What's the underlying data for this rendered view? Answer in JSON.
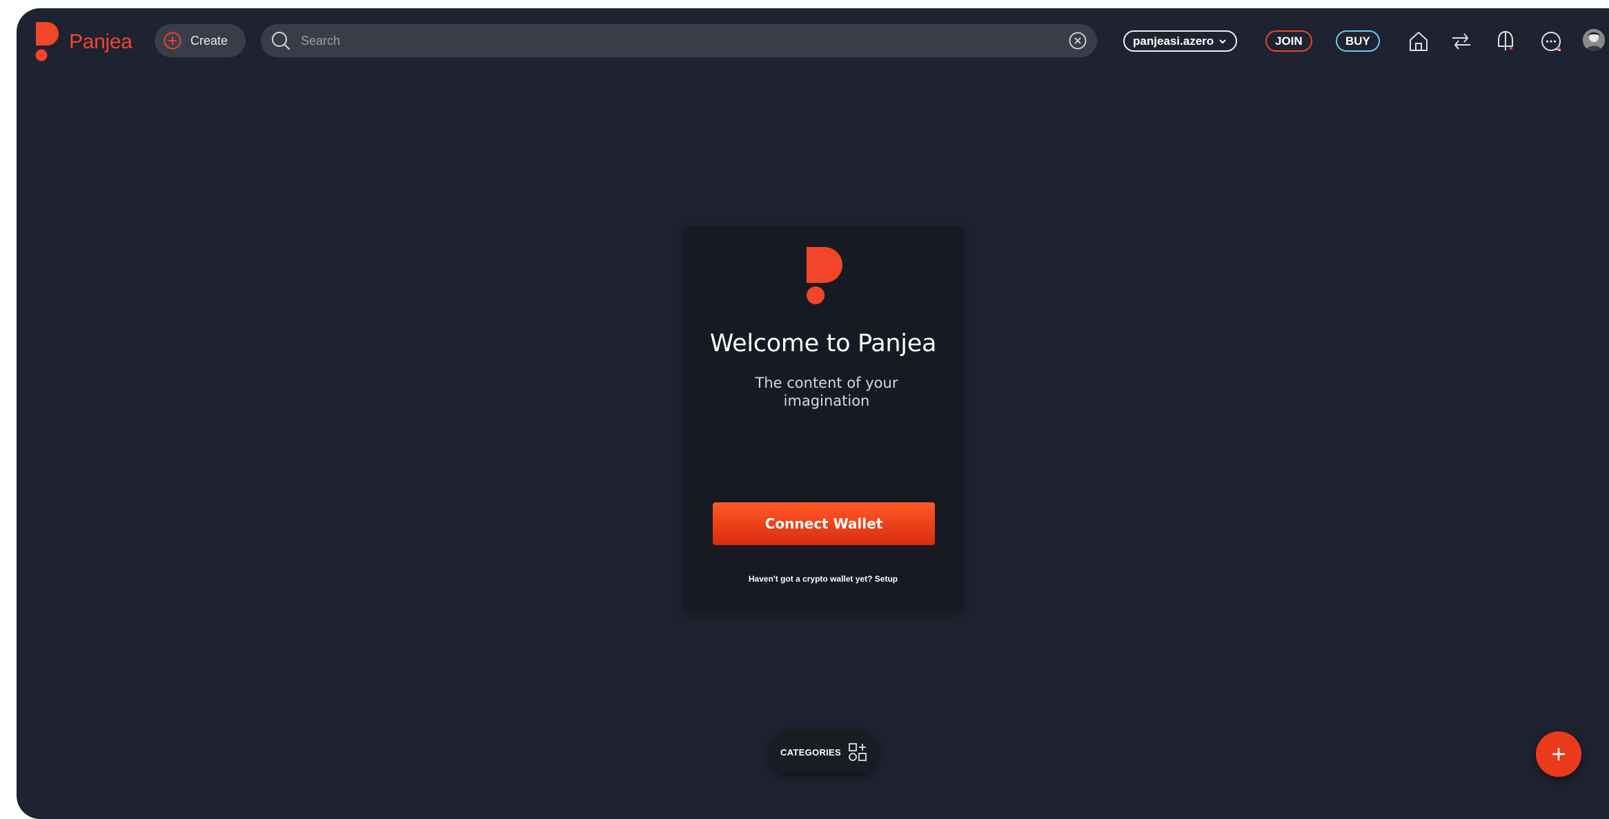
{
  "brand": {
    "name": "Panjea",
    "accent_color": "#f2452a"
  },
  "header": {
    "create_label": "Create",
    "search": {
      "placeholder": "Search",
      "value": ""
    },
    "account_label": "panjeasi.azero",
    "join_label": "JOIN",
    "buy_label": "BUY",
    "nav_icons": [
      "home-icon",
      "transfer-icon",
      "notifications-icon",
      "chat-icon"
    ]
  },
  "welcome_card": {
    "title": "Welcome to Panjea",
    "subtitle": "The content of your imagination",
    "connect_label": "Connect Wallet",
    "footnote_text": "Haven't got a crypto wallet yet?",
    "setup_label": "Setup"
  },
  "bottom": {
    "categories_label": "CATEGORIES",
    "fab_icon": "plus-icon"
  },
  "colors": {
    "background": "#1f2230",
    "card": "#171a23",
    "accent": "#ea3a1c",
    "buy_outline": "#5fd3e6"
  }
}
